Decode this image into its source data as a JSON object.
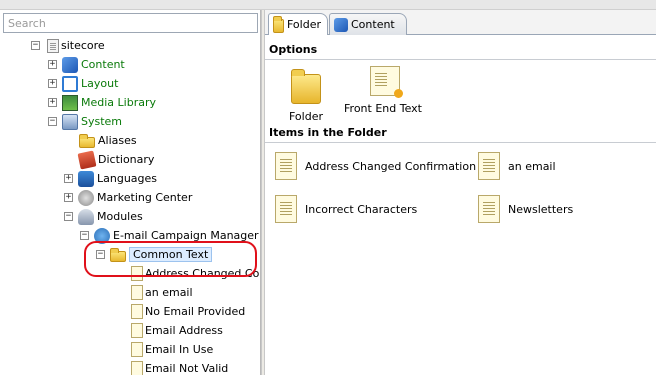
{
  "search": {
    "placeholder": "Search"
  },
  "tree": {
    "root": "sitecore",
    "content": "Content",
    "layout": "Layout",
    "media_library": "Media Library",
    "system": "System",
    "aliases": "Aliases",
    "dictionary": "Dictionary",
    "languages": "Languages",
    "marketing_center": "Marketing Center",
    "modules": "Modules",
    "email_campaign_manager": "E-mail Campaign Manager",
    "common_text": "Common Text",
    "children": [
      "Address Changed Cont",
      "an email",
      "No Email Provided",
      "Email Address",
      "Email In Use",
      "Email Not Valid"
    ]
  },
  "tabs": [
    "Folder",
    "Content"
  ],
  "options": {
    "title": "Options",
    "buttons": [
      "Folder",
      "Front End Text"
    ]
  },
  "items": {
    "title": "Items in the Folder",
    "list": [
      "Address Changed Confirmation",
      "an email",
      "Incorrect Characters",
      "Newsletters"
    ]
  },
  "colors": {
    "highlight": "#e0101a",
    "tree_green": "#0a7a0a"
  }
}
